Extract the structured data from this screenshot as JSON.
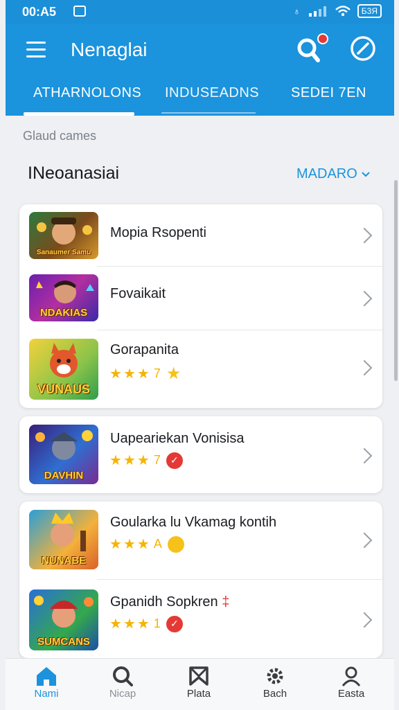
{
  "status_bar": {
    "time": "00:A5",
    "battery": "Б3Я"
  },
  "app_bar": {
    "title": "Nenaglai"
  },
  "tabs": [
    {
      "label": "ATHARNOLONS"
    },
    {
      "label": "INDUSEADNS"
    },
    {
      "label": "SEDEI 7EN"
    }
  ],
  "section": {
    "hint": "Glaud cames",
    "title": "INeoanasiai",
    "sort_label": "MADARO"
  },
  "games": [
    {
      "name": "Mopia Rsopenti",
      "thumb_text": "Sanaumer Samu",
      "badge": ""
    },
    {
      "name": "Fovaikait",
      "thumb_text": "NDAKIAS",
      "badge": ""
    },
    {
      "name": "Gorapanita",
      "thumb_text": "VUNAUS",
      "star_note": "7",
      "badge": "yellow"
    },
    {
      "name": "Uapeariekan Vonisisa",
      "thumb_text": "DAVHIN",
      "star_note": "7",
      "badge": "red"
    },
    {
      "name": "Goularka lu Vkamag kontih",
      "thumb_text": "NUNABE",
      "star_note": "A",
      "badge": "yellow"
    },
    {
      "name": "Gpanidh Sopkren",
      "name_suffix": "‡",
      "thumb_text": "SUMCANS",
      "star_note": "1",
      "badge": "red"
    }
  ],
  "bottom_nav": [
    {
      "label": "Nami"
    },
    {
      "label": "Nicap"
    },
    {
      "label": "Plata"
    },
    {
      "label": "Bach"
    },
    {
      "label": "Easta"
    }
  ],
  "colors": {
    "primary": "#1b93dd",
    "star": "#f6b400",
    "badge_red": "#e53935",
    "badge_yellow": "#f6c21a"
  }
}
